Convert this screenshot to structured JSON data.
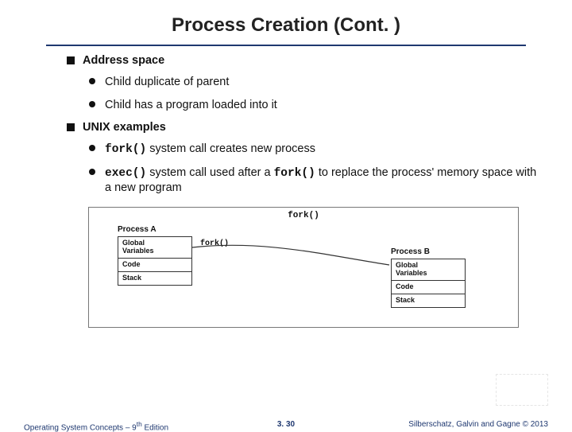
{
  "title": "Process Creation (Cont. )",
  "bullets": {
    "b1": "Address space",
    "b1a": "Child duplicate of parent",
    "b1b": "Child has a program loaded into it",
    "b2": "UNIX examples",
    "b2a_code": "fork()",
    "b2a_rest": " system call creates new process",
    "b2b_code1": "exec()",
    "b2b_mid": " system call used after a ",
    "b2b_code2": "fork()",
    "b2b_rest": " to replace the process' memory space with a new program"
  },
  "diagram": {
    "top_label": "fork()",
    "procA_title": "Process A",
    "procB_title": "Process B",
    "rows": {
      "r1": "Global",
      "r1b": "Variables",
      "r2": "Code",
      "r3": "Stack"
    },
    "fork_label": "fork()"
  },
  "footer": {
    "left_a": "Operating System Concepts – 9",
    "left_sup": "th",
    "left_b": " Edition",
    "mid": "3. 30",
    "right": "Silberschatz, Galvin and Gagne © 2013"
  }
}
